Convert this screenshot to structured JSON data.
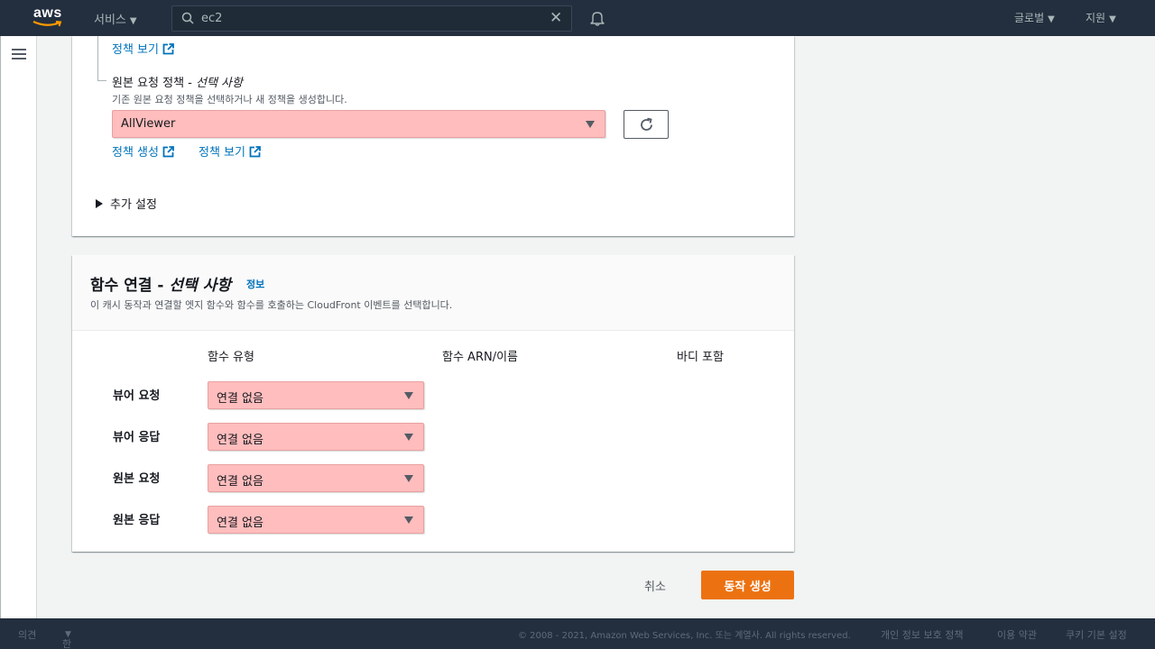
{
  "nav": {
    "logo": "aws",
    "services": "서비스",
    "search_value": "ec2",
    "global": "글로벌",
    "support": "지원"
  },
  "panel1": {
    "view_policy_top": "정책 보기",
    "origin_label": "원본 요청 정책 - ",
    "origin_label_optional": "선택 사항",
    "origin_desc": "기존 원본 요청 정책을 선택하거나 새 정책을 생성합니다.",
    "origin_select_value": "AllViewer",
    "create_policy": "정책 생성",
    "view_policy": "정책 보기",
    "additional_settings": "추가 설정"
  },
  "panel2": {
    "title": "함수 연결 - ",
    "title_optional": "선택 사항",
    "info": "정보",
    "desc": "이 캐시 동작과 연결할 엣지 함수와 함수를 호출하는 CloudFront 이벤트를 선택합니다.",
    "columns": [
      "함수 유형",
      "함수 ARN/이름",
      "바디 포함"
    ],
    "rows": [
      {
        "label": "뷰어 요청",
        "value": "연결 없음"
      },
      {
        "label": "뷰어 응답",
        "value": "연결 없음"
      },
      {
        "label": "원본 요청",
        "value": "연결 없음"
      },
      {
        "label": "원본 응답",
        "value": "연결 없음"
      }
    ]
  },
  "actions": {
    "cancel": "취소",
    "create": "동작 생성"
  },
  "footer": {
    "feedback": "의견",
    "language": "한국어",
    "copyright": "© 2008 - 2021, Amazon Web Services, Inc. 또는 계열사. All rights reserved.",
    "privacy": "개인 정보 보호 정책",
    "terms": "이용 약관",
    "cookies": "쿠키 기본 설정"
  },
  "colors": {
    "nav_bg": "#232f3e",
    "link": "#0073bb",
    "primary_button": "#ec7211",
    "select_highlight": "#ffbdbd"
  }
}
